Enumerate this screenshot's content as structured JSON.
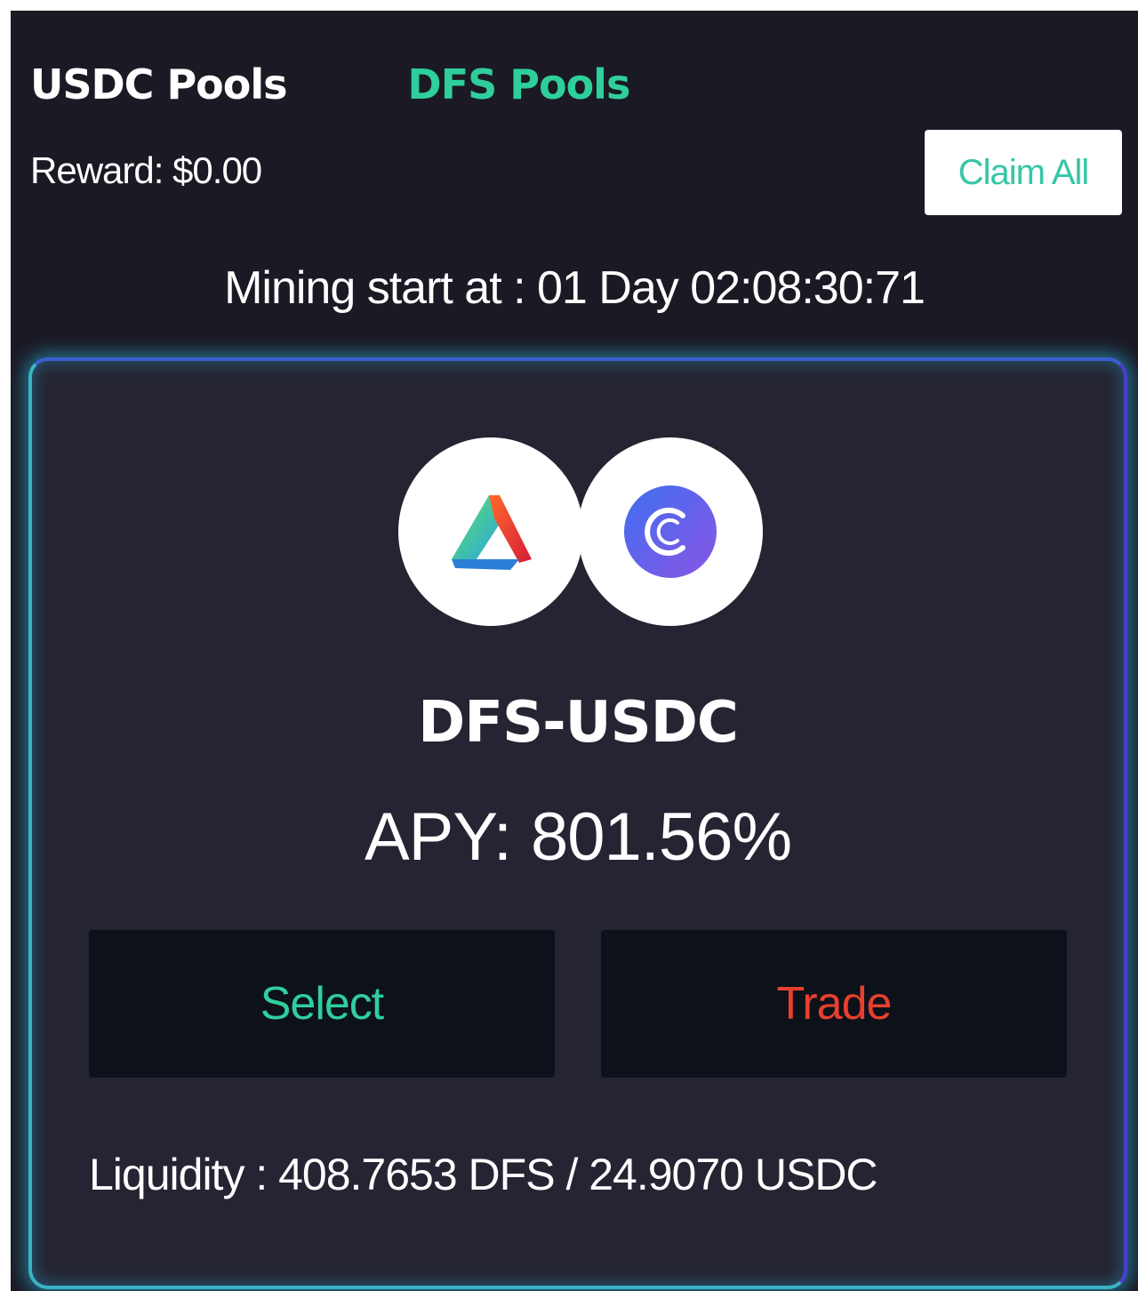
{
  "tabs": {
    "usdc_pools": "USDC Pools",
    "dfs_pools": "DFS Pools"
  },
  "reward_text": "Reward: $0.00",
  "claim_all_label": "Claim All",
  "mining_text": "Mining start at : 01 Day 02:08:30:71",
  "pool": {
    "pair_name": "DFS-USDC",
    "apy_label": "APY:",
    "apy_value": "801.56%",
    "select_label": "Select",
    "trade_label": "Trade",
    "liquidity_text": "Liquidity : 408.7653 DFS / 24.9070 USDC",
    "icons": {
      "left": "dfs-token-icon",
      "right": "usdc-token-icon"
    }
  },
  "colors": {
    "accent_green": "#2fcf9c",
    "trade_red": "#e8402e",
    "background": "#1b1a24",
    "card": "#252433"
  }
}
